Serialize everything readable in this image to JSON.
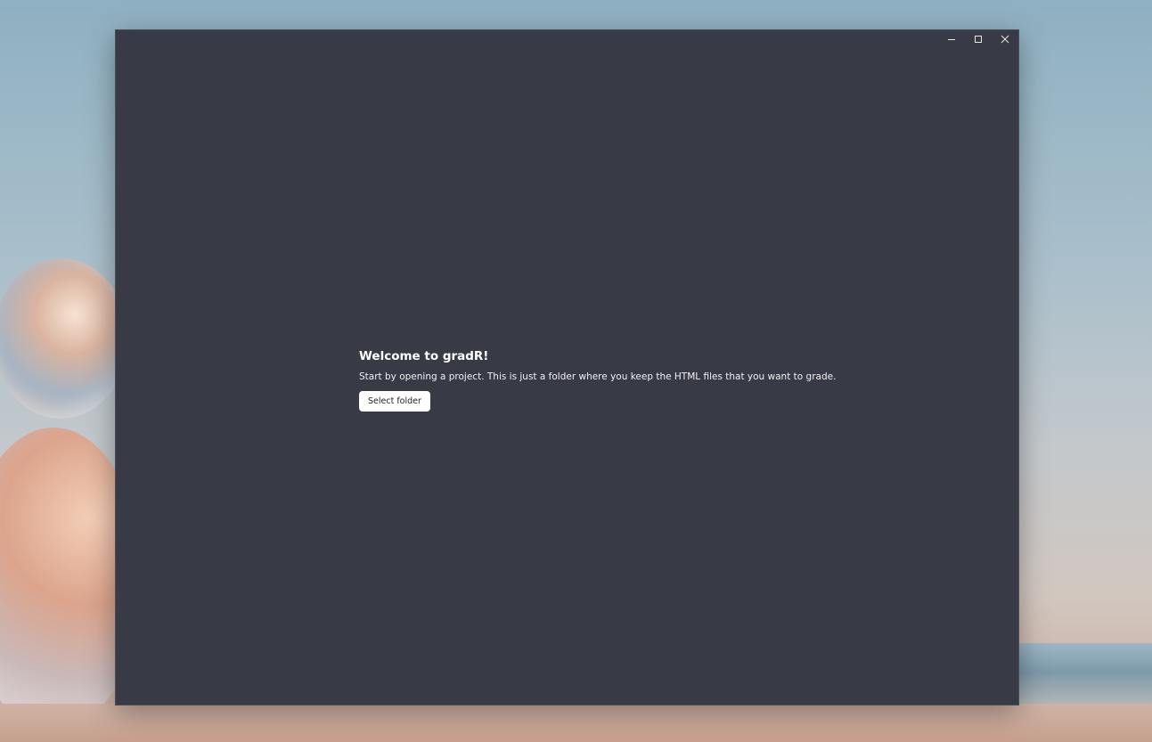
{
  "window": {
    "controls": {
      "minimize_icon": "minimize-icon",
      "maximize_icon": "maximize-icon",
      "close_icon": "close-icon"
    }
  },
  "welcome": {
    "title": "Welcome to gradR!",
    "description": "Start by opening a project. This is just a folder where you keep the HTML files that you want to grade.",
    "select_folder_label": "Select folder"
  },
  "colors": {
    "window_background": "#383a45",
    "button_background": "#ffffff",
    "text": "#ffffff"
  }
}
